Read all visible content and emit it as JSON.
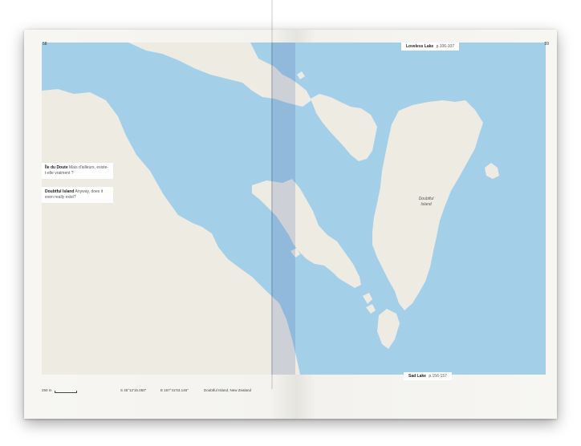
{
  "pages": {
    "left": "58",
    "right": "59"
  },
  "top_label": {
    "name": "Loveless Lake",
    "pages": "p.106-107"
  },
  "bottom_label": {
    "name": "Sad Lake",
    "pages": "p.156-157"
  },
  "notes": [
    {
      "title": "Île du Doute",
      "text": "Mais d'ailleurs, existe-t-elle vraiment ?"
    },
    {
      "title": "Doubtful Island",
      "text": "Anyway, does it even really exist?"
    }
  ],
  "island_label": "Doubtful Island",
  "footer": {
    "scale": "250 m",
    "latitude": "S 45°12'15.050\"",
    "longitude": "E 167°41'03.146\"",
    "place": "Doubtful Island, New Zealand"
  },
  "colors": {
    "water": "#a3cfe8",
    "land": "#eeebe3",
    "page": "#f6f5f1"
  }
}
